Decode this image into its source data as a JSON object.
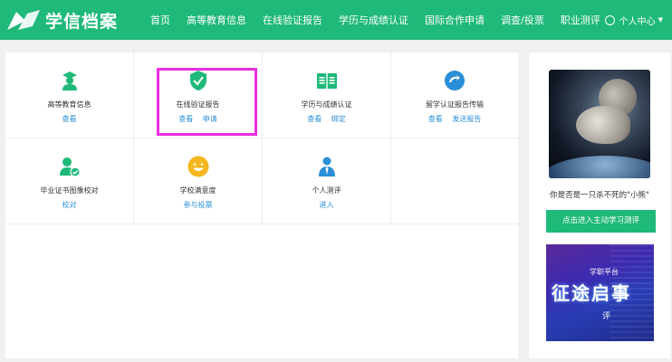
{
  "header": {
    "logo_text": "学信档案",
    "nav": [
      "首页",
      "高等教育信息",
      "在线验证报告",
      "学历与成绩认证",
      "国际合作申请",
      "调查/投票",
      "职业测评"
    ],
    "user_label": "个人中心",
    "icons": {
      "logo": "book-logo-icon",
      "user": "user-circle-icon",
      "menu": "chevron-down-icon"
    }
  },
  "colors": {
    "brand": "#1fb97a",
    "link": "#2a8fd6",
    "highlight": "#ea2fe1",
    "icon_blue": "#2a8fd6",
    "icon_yellow": "#f5b71d"
  },
  "services": [
    {
      "title": "高等教育信息",
      "links": [
        "查看"
      ],
      "icon": "graduate-icon"
    },
    {
      "title": "在线验证报告",
      "links": [
        "查看",
        "申请"
      ],
      "icon": "shield-check-icon"
    },
    {
      "title": "学历与成绩认证",
      "links": [
        "查看",
        "绑定"
      ],
      "icon": "open-book-icon"
    },
    {
      "title": "留学认证报告传输",
      "links": [
        "查看",
        "发送报告"
      ],
      "icon": "transfer-globe-icon"
    },
    {
      "title": "毕业证书图像校对",
      "links": [
        "校对"
      ],
      "icon": "user-check-icon"
    },
    {
      "title": "学校满意度",
      "links": [
        "参与投票"
      ],
      "icon": "smiley-icon"
    },
    {
      "title": "个人测评",
      "links": [
        "进入"
      ],
      "icon": "person-tie-icon"
    }
  ],
  "sidebar": {
    "caption": "你是否是一只杀不死的\"小熊\"",
    "button": "点击进入主动学习测评",
    "banner": {
      "line1": "学职平台",
      "line2": "征途启事",
      "line3": "评"
    }
  }
}
